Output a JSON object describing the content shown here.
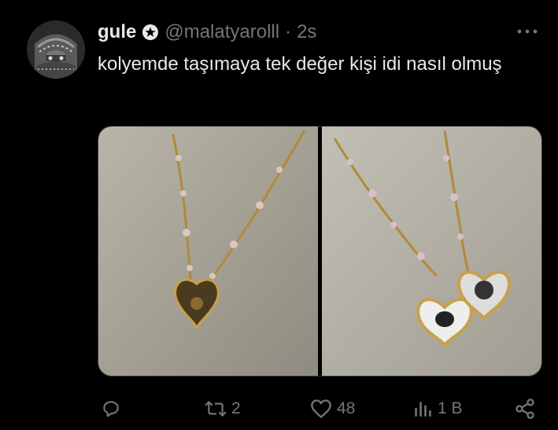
{
  "author": {
    "name": "gule",
    "handle": "@malatyarolll",
    "separator": "·",
    "time": "2s",
    "avatar_icon": "avatar-image",
    "badge_icon": "verified-star-badge-icon"
  },
  "tweet": {
    "text": "kolyemde taşımaya tek değer kişi idi nasıl olmuş"
  },
  "media": {
    "images": [
      "closed-heart-locket-necklace",
      "open-heart-locket-necklace-with-photos"
    ]
  },
  "actions": {
    "reply_icon": "reply-icon",
    "retweet_count": "2",
    "like_count": "48",
    "views_count": "1 B",
    "share_icon": "share-icon"
  },
  "colors": {
    "background": "#000000",
    "text": "#e7e9ea",
    "muted": "#71767b",
    "border": "#2f3336"
  }
}
